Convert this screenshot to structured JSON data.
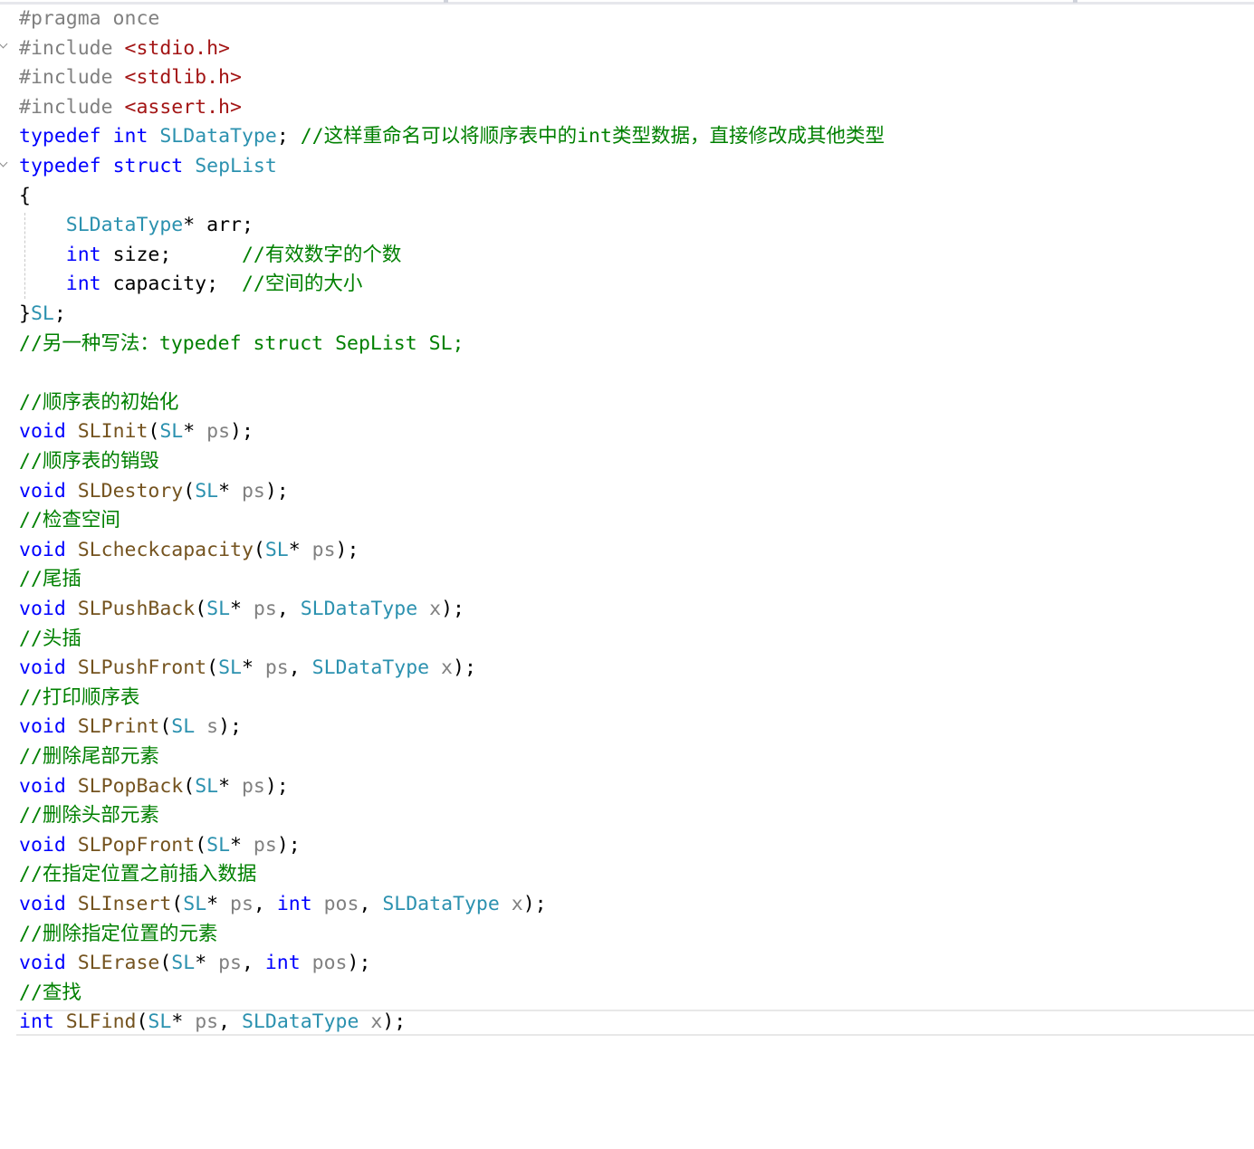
{
  "lines": [
    [
      {
        "t": "#pragma once",
        "c": "pp"
      }
    ],
    [
      {
        "t": "#include ",
        "c": "pp"
      },
      {
        "t": "<stdio.h>",
        "c": "str"
      }
    ],
    [
      {
        "t": "#include ",
        "c": "pp"
      },
      {
        "t": "<stdlib.h>",
        "c": "str"
      }
    ],
    [
      {
        "t": "#include ",
        "c": "pp"
      },
      {
        "t": "<assert.h>",
        "c": "str"
      }
    ],
    [
      {
        "t": "typedef",
        "c": "kw"
      },
      {
        "t": " "
      },
      {
        "t": "int",
        "c": "kw"
      },
      {
        "t": " "
      },
      {
        "t": "SLDataType",
        "c": "ty"
      },
      {
        "t": "; "
      },
      {
        "t": "//这样重命名可以将顺序表中的int类型数据，直接修改成其他类型",
        "c": "cm"
      }
    ],
    [
      {
        "t": "typedef",
        "c": "kw"
      },
      {
        "t": " "
      },
      {
        "t": "struct",
        "c": "kw"
      },
      {
        "t": " "
      },
      {
        "t": "SepList",
        "c": "ty"
      }
    ],
    [
      {
        "t": "{"
      }
    ],
    [
      {
        "t": "    "
      },
      {
        "t": "SLDataType",
        "c": "ty"
      },
      {
        "t": "* arr;"
      }
    ],
    [
      {
        "t": "    "
      },
      {
        "t": "int",
        "c": "kw"
      },
      {
        "t": " size;      "
      },
      {
        "t": "//有效数字的个数",
        "c": "cm"
      }
    ],
    [
      {
        "t": "    "
      },
      {
        "t": "int",
        "c": "kw"
      },
      {
        "t": " capacity;  "
      },
      {
        "t": "//空间的大小",
        "c": "cm"
      }
    ],
    [
      {
        "t": "}"
      },
      {
        "t": "SL",
        "c": "ty"
      },
      {
        "t": ";"
      }
    ],
    [
      {
        "t": "//另一种写法：typedef struct SepList SL;",
        "c": "cm"
      }
    ],
    [],
    [
      {
        "t": "//顺序表的初始化",
        "c": "cm"
      }
    ],
    [
      {
        "t": "void",
        "c": "kw"
      },
      {
        "t": " "
      },
      {
        "t": "SLInit",
        "c": "fn"
      },
      {
        "t": "("
      },
      {
        "t": "SL",
        "c": "ty"
      },
      {
        "t": "* "
      },
      {
        "t": "ps",
        "c": "pm"
      },
      {
        "t": ");"
      }
    ],
    [
      {
        "t": "//顺序表的销毁",
        "c": "cm"
      }
    ],
    [
      {
        "t": "void",
        "c": "kw"
      },
      {
        "t": " "
      },
      {
        "t": "SLDestory",
        "c": "fn"
      },
      {
        "t": "("
      },
      {
        "t": "SL",
        "c": "ty"
      },
      {
        "t": "* "
      },
      {
        "t": "ps",
        "c": "pm"
      },
      {
        "t": ");"
      }
    ],
    [
      {
        "t": "//检查空间",
        "c": "cm"
      }
    ],
    [
      {
        "t": "void",
        "c": "kw"
      },
      {
        "t": " "
      },
      {
        "t": "SLcheckcapacity",
        "c": "fn"
      },
      {
        "t": "("
      },
      {
        "t": "SL",
        "c": "ty"
      },
      {
        "t": "* "
      },
      {
        "t": "ps",
        "c": "pm"
      },
      {
        "t": ");"
      }
    ],
    [
      {
        "t": "//尾插",
        "c": "cm"
      }
    ],
    [
      {
        "t": "void",
        "c": "kw"
      },
      {
        "t": " "
      },
      {
        "t": "SLPushBack",
        "c": "fn"
      },
      {
        "t": "("
      },
      {
        "t": "SL",
        "c": "ty"
      },
      {
        "t": "* "
      },
      {
        "t": "ps",
        "c": "pm"
      },
      {
        "t": ", "
      },
      {
        "t": "SLDataType",
        "c": "ty"
      },
      {
        "t": " "
      },
      {
        "t": "x",
        "c": "pm"
      },
      {
        "t": ");"
      }
    ],
    [
      {
        "t": "//头插",
        "c": "cm"
      }
    ],
    [
      {
        "t": "void",
        "c": "kw"
      },
      {
        "t": " "
      },
      {
        "t": "SLPushFront",
        "c": "fn"
      },
      {
        "t": "("
      },
      {
        "t": "SL",
        "c": "ty"
      },
      {
        "t": "* "
      },
      {
        "t": "ps",
        "c": "pm"
      },
      {
        "t": ", "
      },
      {
        "t": "SLDataType",
        "c": "ty"
      },
      {
        "t": " "
      },
      {
        "t": "x",
        "c": "pm"
      },
      {
        "t": ");"
      }
    ],
    [
      {
        "t": "//打印顺序表",
        "c": "cm"
      }
    ],
    [
      {
        "t": "void",
        "c": "kw"
      },
      {
        "t": " "
      },
      {
        "t": "SLPrint",
        "c": "fn"
      },
      {
        "t": "("
      },
      {
        "t": "SL",
        "c": "ty"
      },
      {
        "t": " "
      },
      {
        "t": "s",
        "c": "pm"
      },
      {
        "t": ");"
      }
    ],
    [
      {
        "t": "//删除尾部元素",
        "c": "cm"
      }
    ],
    [
      {
        "t": "void",
        "c": "kw"
      },
      {
        "t": " "
      },
      {
        "t": "SLPopBack",
        "c": "fn"
      },
      {
        "t": "("
      },
      {
        "t": "SL",
        "c": "ty"
      },
      {
        "t": "* "
      },
      {
        "t": "ps",
        "c": "pm"
      },
      {
        "t": ");"
      }
    ],
    [
      {
        "t": "//删除头部元素",
        "c": "cm"
      }
    ],
    [
      {
        "t": "void",
        "c": "kw"
      },
      {
        "t": " "
      },
      {
        "t": "SLPopFront",
        "c": "fn"
      },
      {
        "t": "("
      },
      {
        "t": "SL",
        "c": "ty"
      },
      {
        "t": "* "
      },
      {
        "t": "ps",
        "c": "pm"
      },
      {
        "t": ");"
      }
    ],
    [
      {
        "t": "//在指定位置之前插入数据",
        "c": "cm"
      }
    ],
    [
      {
        "t": "void",
        "c": "kw"
      },
      {
        "t": " "
      },
      {
        "t": "SLInsert",
        "c": "fn"
      },
      {
        "t": "("
      },
      {
        "t": "SL",
        "c": "ty"
      },
      {
        "t": "* "
      },
      {
        "t": "ps",
        "c": "pm"
      },
      {
        "t": ", "
      },
      {
        "t": "int",
        "c": "kw"
      },
      {
        "t": " "
      },
      {
        "t": "pos",
        "c": "pm"
      },
      {
        "t": ", "
      },
      {
        "t": "SLDataType",
        "c": "ty"
      },
      {
        "t": " "
      },
      {
        "t": "x",
        "c": "pm"
      },
      {
        "t": ");"
      }
    ],
    [
      {
        "t": "//删除指定位置的元素",
        "c": "cm"
      }
    ],
    [
      {
        "t": "void",
        "c": "kw"
      },
      {
        "t": " "
      },
      {
        "t": "SLErase",
        "c": "fn"
      },
      {
        "t": "("
      },
      {
        "t": "SL",
        "c": "ty"
      },
      {
        "t": "* "
      },
      {
        "t": "ps",
        "c": "pm"
      },
      {
        "t": ", "
      },
      {
        "t": "int",
        "c": "kw"
      },
      {
        "t": " "
      },
      {
        "t": "pos",
        "c": "pm"
      },
      {
        "t": ");"
      }
    ],
    [
      {
        "t": "//查找",
        "c": "cm"
      }
    ],
    [
      {
        "t": "int",
        "c": "kw"
      },
      {
        "t": " "
      },
      {
        "t": "SLFind",
        "c": "fn"
      },
      {
        "t": "("
      },
      {
        "t": "SL",
        "c": "ty"
      },
      {
        "t": "* "
      },
      {
        "t": "ps",
        "c": "pm"
      },
      {
        "t": ", "
      },
      {
        "t": "SLDataType",
        "c": "ty"
      },
      {
        "t": " "
      },
      {
        "t": "x",
        "c": "pm"
      },
      {
        "t": ");"
      }
    ]
  ]
}
